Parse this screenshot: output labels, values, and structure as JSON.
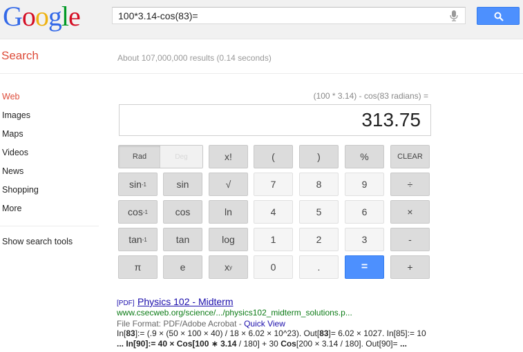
{
  "header": {
    "logo": [
      "G",
      "o",
      "o",
      "g",
      "l",
      "e"
    ],
    "logo_colors": [
      "#3369e8",
      "#d50f25",
      "#eeb211",
      "#3369e8",
      "#009925",
      "#d50f25"
    ],
    "search_value": "100*3.14-cos(83)="
  },
  "subheader": {
    "label": "Search",
    "stats": "About 107,000,000 results (0.14 seconds)"
  },
  "nav": {
    "items": [
      "Web",
      "Images",
      "Maps",
      "Videos",
      "News",
      "Shopping",
      "More"
    ],
    "active": "Web",
    "tools": "Show search tools"
  },
  "calculator": {
    "expression": "(100 * 3.14) - cos(83 radians) =",
    "result": "313.75",
    "rad_label": "Rad",
    "deg_label": "Deg",
    "keys": {
      "fact": "x!",
      "lparen": "(",
      "rparen": ")",
      "percent": "%",
      "clear": "CLEAR",
      "sin_inv": "sin",
      "sin": "sin",
      "sqrt": "√",
      "n7": "7",
      "n8": "8",
      "n9": "9",
      "divide": "÷",
      "cos_inv": "cos",
      "cos": "cos",
      "ln": "ln",
      "n4": "4",
      "n5": "5",
      "n6": "6",
      "multiply": "×",
      "tan_inv": "tan",
      "tan": "tan",
      "log": "log",
      "n1": "1",
      "n2": "2",
      "n3": "3",
      "minus": "-",
      "pi": "π",
      "e": "e",
      "power_base": "x",
      "power_exp": "y",
      "n0": "0",
      "dot": ".",
      "equals": "=",
      "plus": "+",
      "inverse_sup": "-1"
    }
  },
  "result": {
    "pdf_tag": "[PDF]",
    "title": "Physics 102 - Midterm",
    "url": "www.csecweb.org/science/.../physics102_midterm_solutions.p...",
    "format_label": "File Format: PDF/Adobe Acrobat - ",
    "quick_view": "Quick View",
    "snippet_line1_a": "In[",
    "snippet_line1_b": "83",
    "snippet_line1_c": "]:= (.9 × (50 × 100 × 40) / 18 × 6.02 × 10^23). Out[",
    "snippet_line1_d": "83",
    "snippet_line1_e": "]= 6.02 × 1027. In[85]:= 10",
    "snippet_line2_a": "... In[90]:= 40 × ",
    "snippet_line2_b": "Cos[100 ∗ 3.14",
    "snippet_line2_c": " / 180] + 30 ",
    "snippet_line2_d": "Cos",
    "snippet_line2_e": "[200 × 3.14 / 180]. Out[90]= ",
    "snippet_line2_f": "..."
  }
}
